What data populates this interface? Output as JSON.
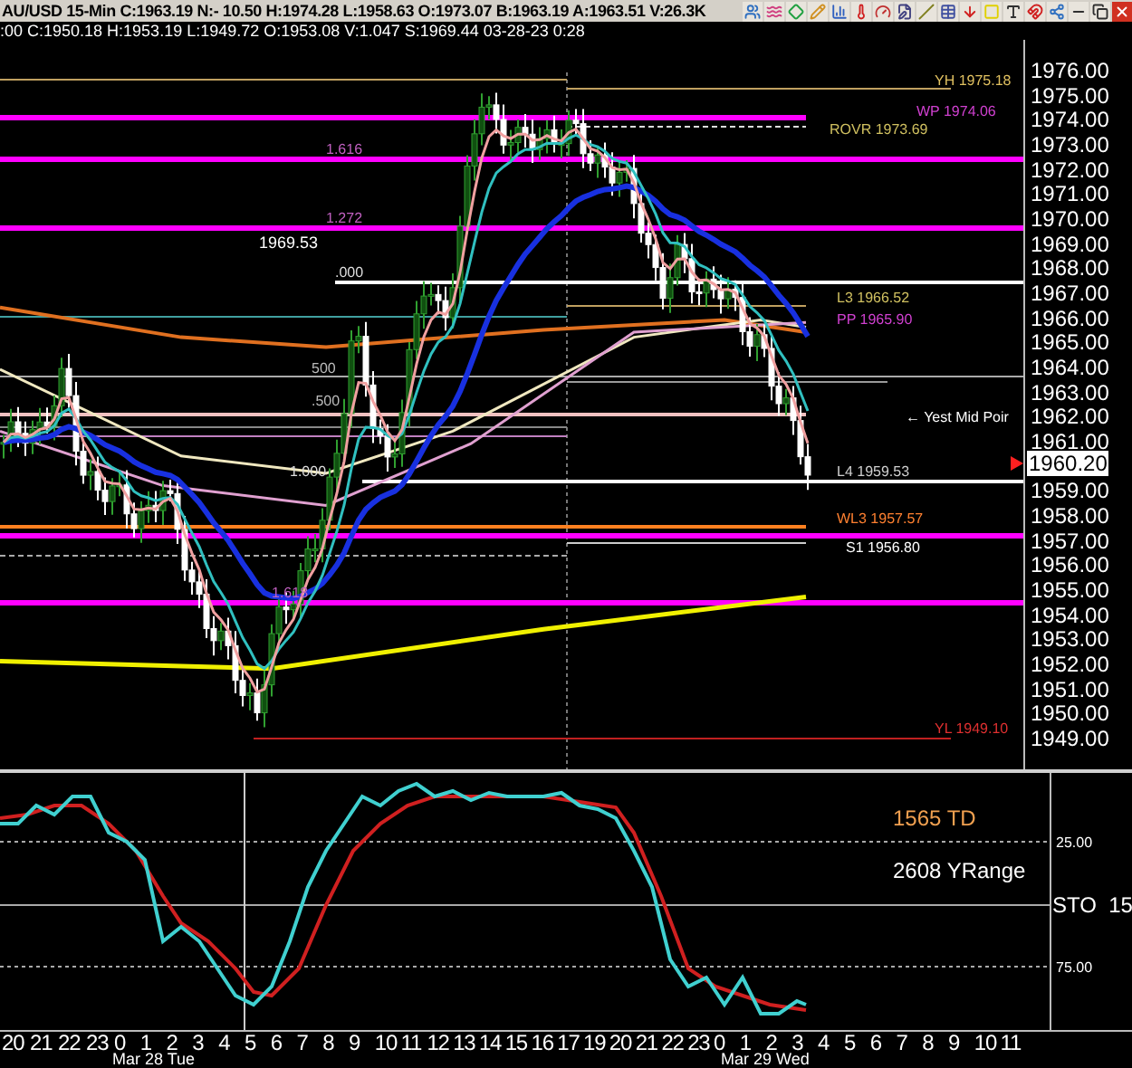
{
  "header": {
    "quote_line": "AU/USD  15-Min  C:1963.19  N:-  10.50  H:1974.28  L:1958.63  O:1973.07  B:1963.19  A:1963.51  V:26.3K"
  },
  "cursor_line": ":00  C:1950.18  H:1953.19  L:1949.72  O:1953.08  V:1.047  S:1969.44  03-28-23  0:28",
  "price_axis": {
    "labels": [
      "1976.00",
      "1975.00",
      "1974.00",
      "1973.00",
      "1972.00",
      "1971.00",
      "1970.00",
      "1969.00",
      "1968.00",
      "1967.00",
      "1966.00",
      "1965.00",
      "1964.00",
      "1963.00",
      "1962.00",
      "1961.00",
      "1959.00",
      "1958.00",
      "1957.00",
      "1956.00",
      "1955.00",
      "1954.00",
      "1953.00",
      "1952.00",
      "1951.00",
      "1950.00",
      "1949.00"
    ],
    "current_price": "1960.20"
  },
  "level_labels": [
    {
      "text": "YH 1975.18",
      "color": "#e0c060"
    },
    {
      "text": "WP 1974.06",
      "color": "#d040d0"
    },
    {
      "text": "ROVR 1973.69",
      "color": "#d0c060"
    },
    {
      "text": "L3 1966.52",
      "color": "#d0c060"
    },
    {
      "text": "PP 1965.90",
      "color": "#d040d0"
    },
    {
      "text": "← Yest Mid Poir",
      "color": "#ffffff"
    },
    {
      "text": "L4 1959.53",
      "color": "#d0d0d0"
    },
    {
      "text": "WL3 1957.57",
      "color": "#ff8030"
    },
    {
      "text": "S1 1956.80",
      "color": "#ffffff"
    },
    {
      "text": "YL 1949.10",
      "color": "#e03030"
    }
  ],
  "fib_labels": [
    "1.616",
    "1.272",
    ".000",
    "500",
    ".500",
    "1.000",
    "1.618"
  ],
  "price_note": "1969.53",
  "stochastic": {
    "labels": [
      {
        "text": "1565 TD",
        "color": "#f0a050"
      },
      {
        "text": "2608 YRange",
        "color": "#ffffff"
      }
    ],
    "axis": [
      "25.00",
      "STO  15",
      "75.00"
    ]
  },
  "time_axis": {
    "hours": [
      "20",
      "21",
      "22",
      "23",
      "0",
      "1",
      "2",
      "3",
      "4",
      "5",
      "6",
      "7",
      "8",
      "9",
      "10",
      "11",
      "12",
      "13",
      "14",
      "15",
      "16",
      "17",
      "19",
      "20",
      "21",
      "22",
      "23",
      "0",
      "1",
      "2",
      "3",
      "4",
      "5",
      "6",
      "7",
      "8",
      "9",
      "10",
      "11"
    ],
    "dates": [
      "Mar 28 Tue",
      "Mar 29 Wed"
    ]
  }
}
